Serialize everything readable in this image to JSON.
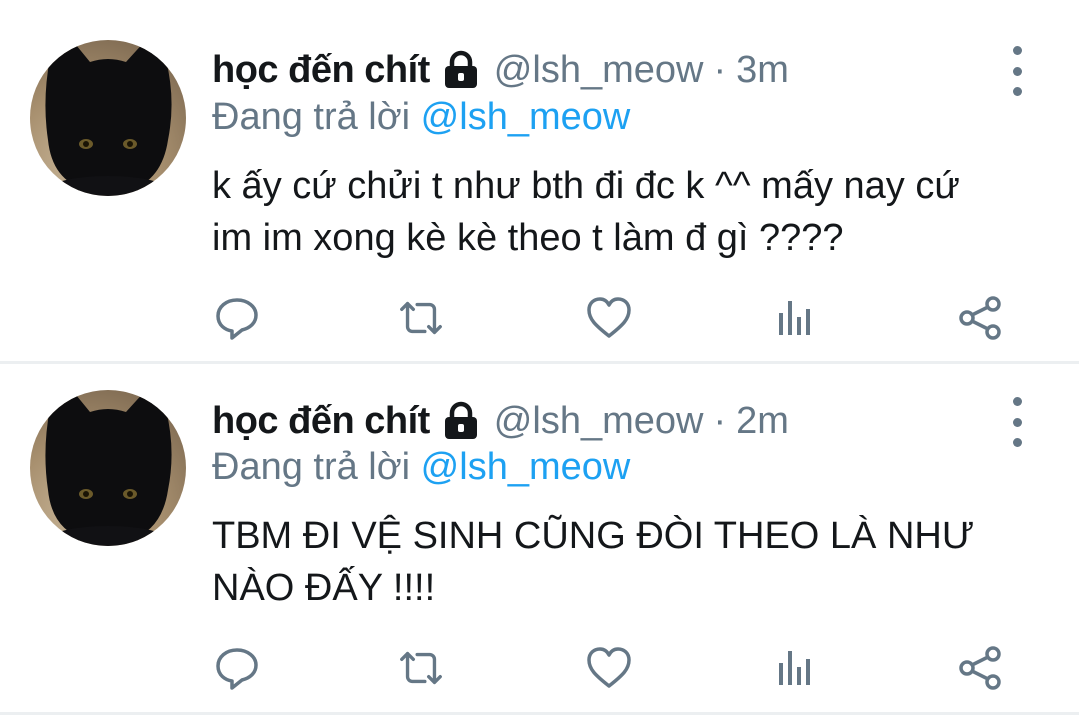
{
  "colors": {
    "text_primary": "#14171a",
    "text_secondary": "#657786",
    "mention": "#1da1f2",
    "divider": "#eceff1"
  },
  "tweets": [
    {
      "display_name": "học đến chít",
      "handle": "@lsh_meow",
      "separator": "·",
      "time": "3m",
      "replying_prefix": "Đang trả lời",
      "replying_to": "@lsh_meow",
      "text_line1": "k ấy cứ chửi t như bth đi đc k ^^ mấy nay cứ",
      "text_line2": "im im xong kè kè theo t làm đ gì ????",
      "icons": [
        "lock-icon",
        "more-vertical-icon",
        "reply-icon",
        "retweet-icon",
        "like-icon",
        "analytics-icon",
        "share-icon"
      ]
    },
    {
      "display_name": "học đến chít",
      "handle": "@lsh_meow",
      "separator": "·",
      "time": "2m",
      "replying_prefix": "Đang trả lời",
      "replying_to": "@lsh_meow",
      "text_line1": "TBM ĐI VỆ SINH CŨNG ĐÒI THEO LÀ NHƯ",
      "text_line2": "NÀO ĐẤY !!!!",
      "icons": [
        "lock-icon",
        "more-vertical-icon",
        "reply-icon",
        "retweet-icon",
        "like-icon",
        "analytics-icon",
        "share-icon"
      ]
    }
  ]
}
